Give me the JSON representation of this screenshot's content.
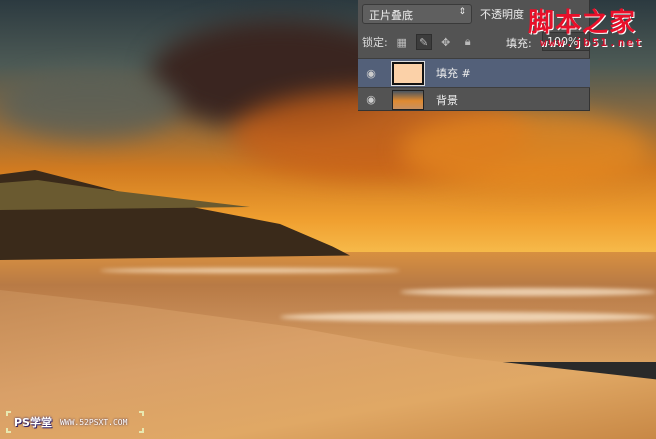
{
  "layers_panel": {
    "blend_mode": "正片叠底",
    "opacity_label": "不透明度",
    "lock_label": "锁定:",
    "fill_label": "填充:",
    "fill_value": "100%",
    "layers": [
      {
        "name": "填充 #",
        "selected": true,
        "thumb_color": "#fbd1a8"
      },
      {
        "name": "背景",
        "selected": false
      }
    ]
  },
  "watermark": {
    "site_name": "脚本之家",
    "site_url": "www.jb51.net"
  },
  "ps_watermark": {
    "logo": "PS学堂",
    "url": "WWW.52PSXT.COM"
  }
}
